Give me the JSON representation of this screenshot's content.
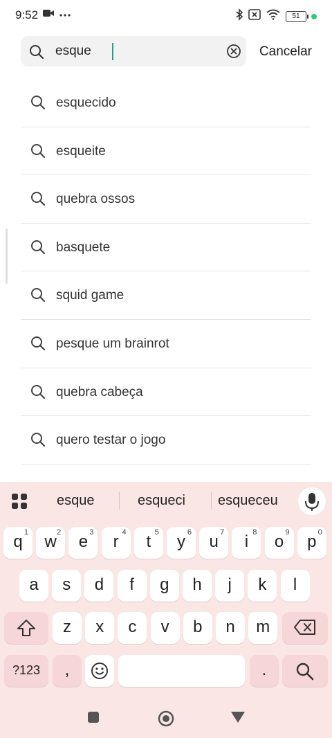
{
  "status_bar": {
    "time": "9:52",
    "battery": "51",
    "left_icons": [
      "video-icon",
      "more-dots-icon"
    ],
    "right_icons": [
      "bluetooth-icon",
      "no-sim-icon",
      "wifi-icon",
      "battery-icon",
      "charging-dot"
    ]
  },
  "search": {
    "value": "esque",
    "cancel_label": "Cancelar"
  },
  "suggestions": [
    "esquecido",
    "esqueite",
    "quebra ossos",
    "basquete",
    "squid game",
    "pesque um brainrot",
    "quebra cabeça",
    "quero testar o jogo"
  ],
  "keyboard": {
    "predictions": [
      "esque",
      "esqueci",
      "esqueceu"
    ],
    "row1": [
      {
        "k": "q",
        "n": "1"
      },
      {
        "k": "w",
        "n": "2"
      },
      {
        "k": "e",
        "n": "3"
      },
      {
        "k": "r",
        "n": "4"
      },
      {
        "k": "t",
        "n": "5"
      },
      {
        "k": "y",
        "n": "6"
      },
      {
        "k": "u",
        "n": "7"
      },
      {
        "k": "i",
        "n": "8"
      },
      {
        "k": "o",
        "n": "9"
      },
      {
        "k": "p",
        "n": "0"
      }
    ],
    "row2": [
      "a",
      "s",
      "d",
      "f",
      "g",
      "h",
      "j",
      "k",
      "l"
    ],
    "row3": [
      "z",
      "x",
      "c",
      "v",
      "b",
      "n",
      "m"
    ],
    "numbers_label": "?123",
    "comma": ",",
    "period": ".",
    "colors": {
      "background": "#fbe6e6",
      "key": "#ffffff",
      "special_key": "#f6d6d6"
    }
  },
  "nav_bar": [
    "recent-apps-icon",
    "home-icon",
    "back-icon"
  ],
  "colors": {
    "caret": "#2a9d8f",
    "charging": "#2ecc71"
  }
}
